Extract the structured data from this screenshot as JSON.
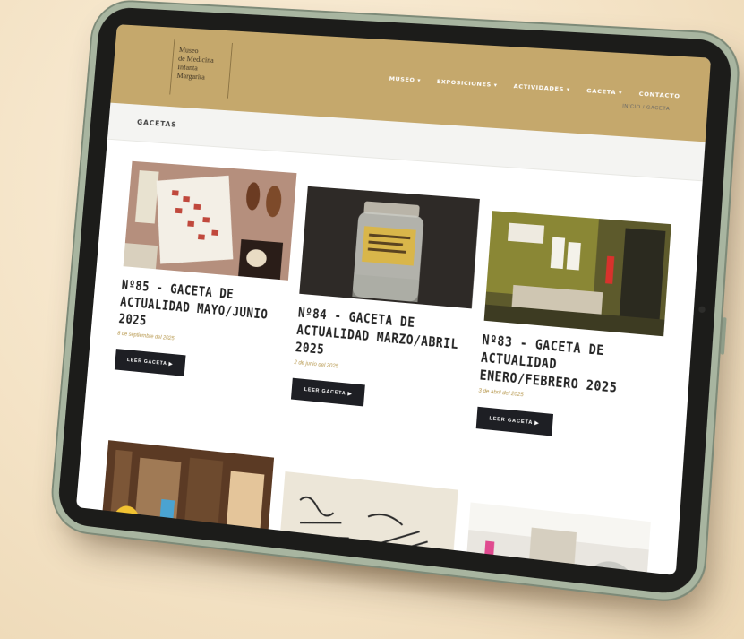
{
  "logo": {
    "lines": [
      "Museo",
      "de Medicina",
      "Infanta",
      "Margarita"
    ]
  },
  "nav": {
    "items": [
      "MUSEO ▾",
      "EXPOSICIONES ▾",
      "ACTIVIDADES ▾",
      "GACETA ▾",
      "CONTACTO"
    ]
  },
  "page": {
    "title": "GACETAS",
    "breadcrumb": "INICIO / GACETA"
  },
  "cards": [
    {
      "title": "Nº85 - GACETA DE ACTUALIDAD MAYO/JUNIO 2025",
      "date": "8 de septiembre del 2025",
      "button": "LEER GACETA ▶"
    },
    {
      "title": "Nº84 - GACETA DE ACTUALIDAD MARZO/ABRIL 2025",
      "date": "2 de junio del 2025",
      "button": "LEER GACETA ▶"
    },
    {
      "title": "Nº83 - GACETA DE ACTUALIDAD ENERO/FEBRERO 2025",
      "date": "3 de abril del 2025",
      "button": "LEER GACETA ▶"
    }
  ],
  "colors": {
    "header": "#c5a86c",
    "button": "#1e1f24",
    "date": "#b59548",
    "tablet_frame": "#1c1c1a",
    "tablet_edge": "#a8b5a0"
  }
}
